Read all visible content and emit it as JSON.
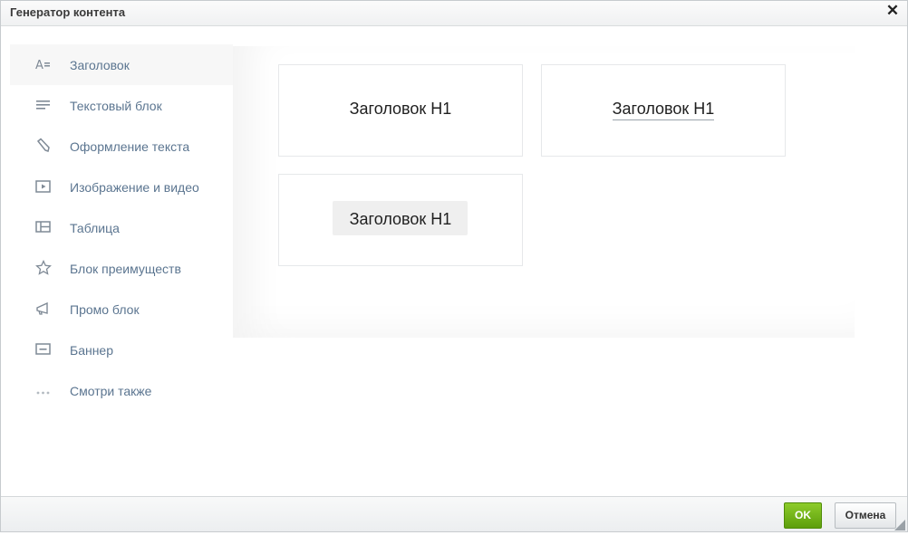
{
  "dialog": {
    "title": "Генератор контента",
    "close_icon": "close-icon"
  },
  "sidebar": {
    "items": [
      {
        "label": "Заголовок",
        "icon": "heading-icon",
        "active": true
      },
      {
        "label": "Текстовый блок",
        "icon": "text-lines-icon"
      },
      {
        "label": "Оформление текста",
        "icon": "pencil-icon"
      },
      {
        "label": "Изображение и видео",
        "icon": "play-video-icon"
      },
      {
        "label": "Таблица",
        "icon": "table-icon"
      },
      {
        "label": "Блок преимуществ",
        "icon": "star-icon"
      },
      {
        "label": "Промо блок",
        "icon": "megaphone-icon"
      },
      {
        "label": "Баннер",
        "icon": "banner-icon"
      },
      {
        "label": "Смотри также",
        "icon": "more-dots-icon"
      }
    ]
  },
  "templates": [
    {
      "label": "Заголовок H1",
      "style": "plain"
    },
    {
      "label": "Заголовок H1",
      "style": "underlined"
    },
    {
      "label": "Заголовок H1",
      "style": "chip-background"
    }
  ],
  "footer": {
    "ok_label": "OK",
    "cancel_label": "Отмена"
  },
  "colors": {
    "ok_button": "#6bb31a",
    "sidebar_label": "#5b7590",
    "sidebar_active_bg": "#f7f7f7"
  }
}
